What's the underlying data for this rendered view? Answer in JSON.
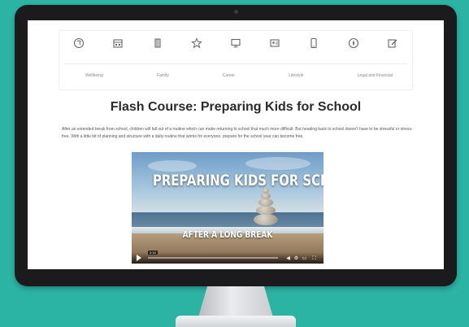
{
  "nav": {
    "icons": [
      "brain-icon",
      "calendar-icon",
      "book-icon",
      "star-icon",
      "monitor-icon",
      "id-card-icon",
      "phone-icon",
      "compass-icon",
      "edit-icon"
    ],
    "categories": [
      "Wellbeing",
      "Family",
      "Career",
      "Lifestyle",
      "Legal and Financial"
    ]
  },
  "page": {
    "title": "Flash Course: Preparing Kids for School",
    "intro": "After an extended break from school, children will fall out of a routine which can make returning to school that much more difficult. But heading back to school doesn't have to be stressful or stress-free. With a little bit of planning and structure with a daily routine that works for everyone, prepare for the school year can become free."
  },
  "video": {
    "title": "PREPARING KIDS FOR SCHOOL",
    "subtitle": "AFTER A LONG BREAK",
    "time": "2:14"
  },
  "colors": {
    "background": "#2bb3a3",
    "bezel": "#1b1b1d",
    "title_text": "#2b2b2b"
  }
}
